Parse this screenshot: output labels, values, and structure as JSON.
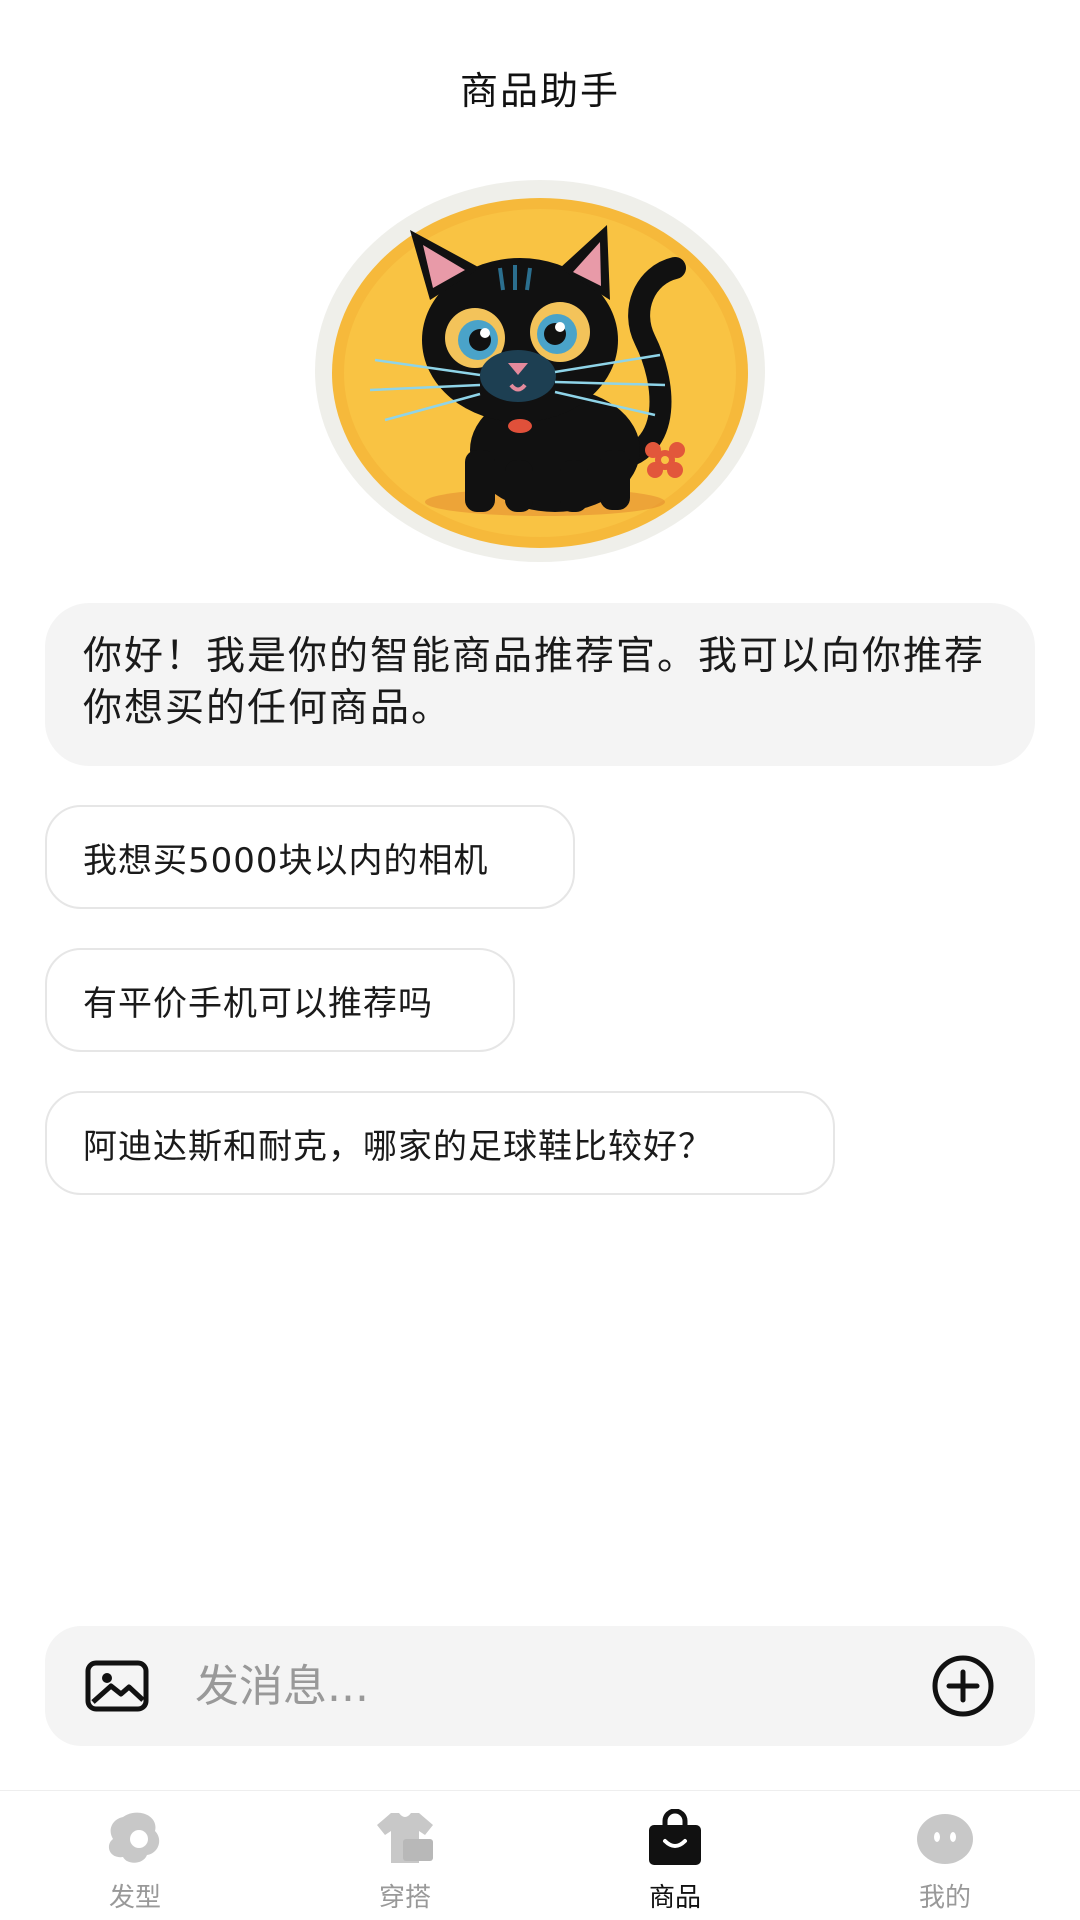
{
  "header": {
    "title": "商品助手"
  },
  "chat": {
    "greeting": "你好！我是你的智能商品推荐官。我可以向你推荐你想买的任何商品。",
    "suggestions": [
      "我想买5000块以内的相机",
      "有平价手机可以推荐吗",
      "阿迪达斯和耐克，哪家的足球鞋比较好？"
    ]
  },
  "composer": {
    "placeholder": "发消息...",
    "image_icon": "image-icon",
    "add_icon": "plus-circle-icon"
  },
  "tabbar": {
    "items": [
      {
        "label": "发型",
        "icon": "hairstyle-icon",
        "active": false
      },
      {
        "label": "穿搭",
        "icon": "outfit-icon",
        "active": false
      },
      {
        "label": "商品",
        "icon": "shopping-bag-icon",
        "active": true
      },
      {
        "label": "我的",
        "icon": "profile-face-icon",
        "active": false
      }
    ]
  },
  "colors": {
    "bubble_bg": "#f4f4f4",
    "inactive_tab": "#999999",
    "active_tab": "#111111",
    "avatar_bg": "#f6b93b"
  }
}
